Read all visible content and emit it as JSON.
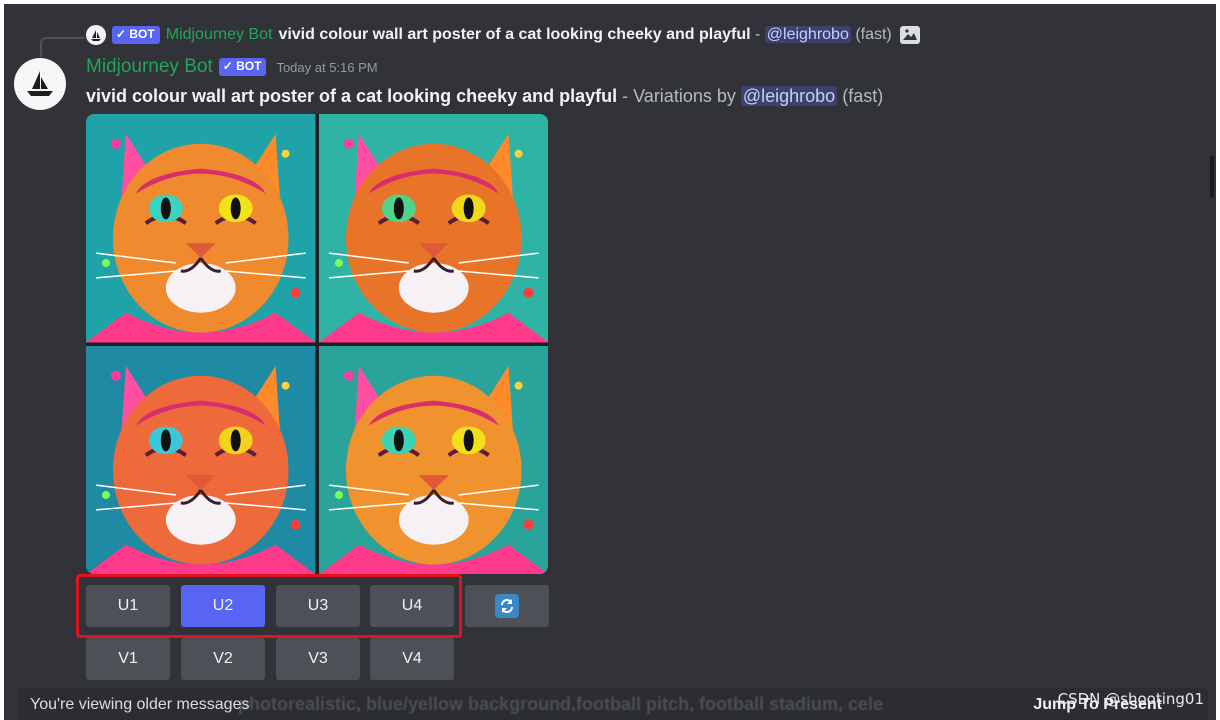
{
  "reply": {
    "author": "Midjourney Bot",
    "bot_tag": "✓ BOT",
    "prompt": "vivid colour wall art poster of a cat looking cheeky and playful",
    "separator": " - ",
    "mention": "@leighrobo",
    "speed": "(fast)"
  },
  "message": {
    "author": "Midjourney Bot",
    "bot_tag": "✓ BOT",
    "timestamp": "Today at 5:16 PM",
    "prompt": "vivid colour wall art poster of a cat looking cheeky and playful",
    "variations_text": " - Variations by ",
    "mention": "@leighrobo",
    "speed": "(fast)",
    "image_icon": "image-icon"
  },
  "buttons": {
    "upscale": [
      "U1",
      "U2",
      "U3",
      "U4"
    ],
    "variation": [
      "V1",
      "V2",
      "V3",
      "V4"
    ],
    "reroll_icon": "reroll-icon",
    "selected": "U2"
  },
  "bottom_bar": {
    "older_label": "You're viewing older messages",
    "jump_label": "Jump To Present",
    "background_text": "photorealistic, blue/yellow background,football pitch, football stadium, cele"
  },
  "watermark": "CSDN @shooting01",
  "colors": {
    "background": "#313338",
    "bot_name": "#23a559",
    "blurple": "#5865f2",
    "button": "#4e5058",
    "highlight": "#e0141e"
  }
}
